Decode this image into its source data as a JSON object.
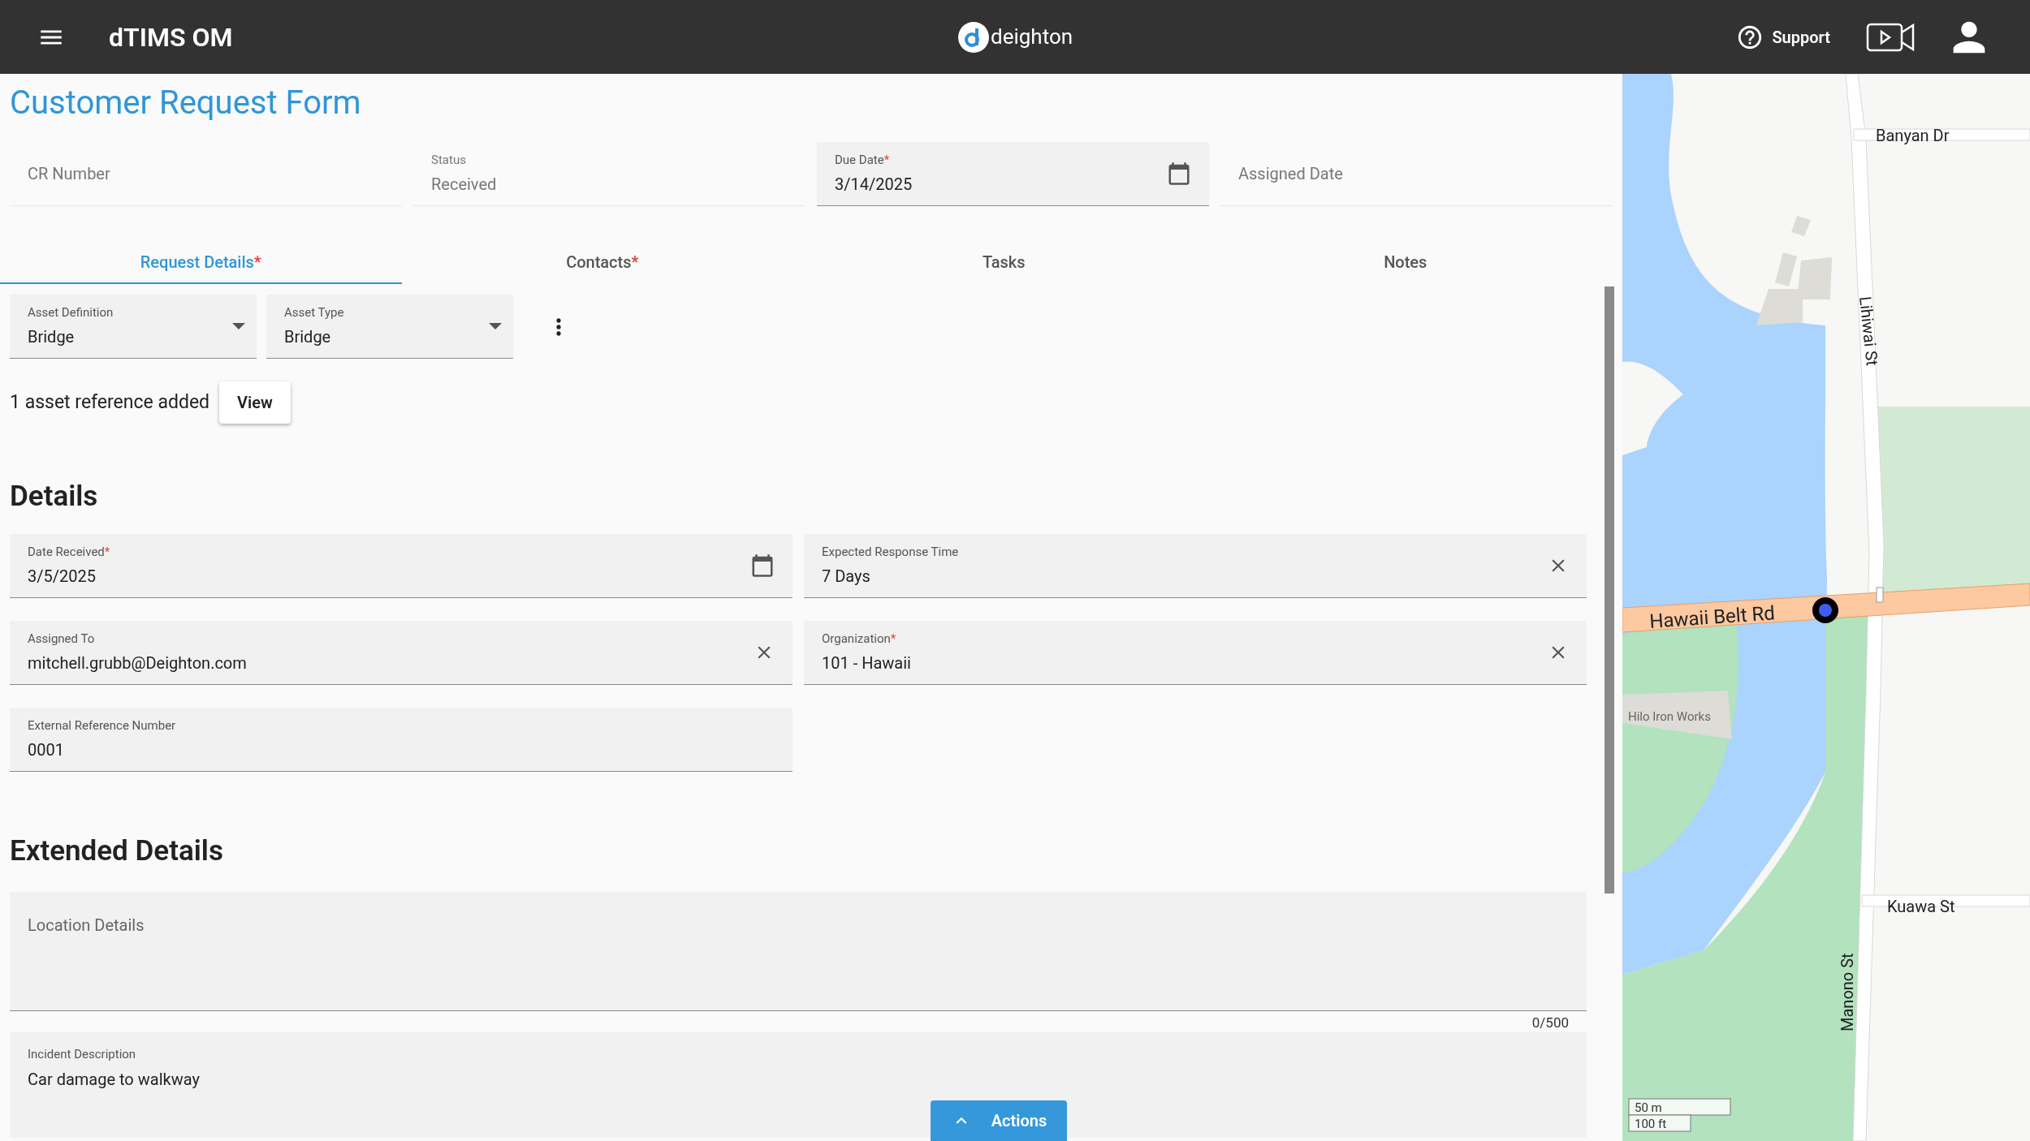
{
  "header": {
    "title": "dTIMS OM",
    "logo_text": "deighton",
    "support": "Support"
  },
  "form": {
    "title": "Customer Request Form",
    "top_fields": [
      {
        "label": "CR Number",
        "disabled": true,
        "kind": "plain"
      },
      {
        "label": "Status",
        "value": "Received",
        "disabled": true,
        "kind": "plain"
      },
      {
        "label": "Due Date",
        "required_mark": "*",
        "value": "3/14/2025",
        "disabled": false,
        "kind": "date"
      },
      {
        "label": "Assigned Date",
        "disabled": true,
        "kind": "plain"
      }
    ],
    "tabs": [
      {
        "label": "Request Details",
        "required_mark": "*",
        "selected": true
      },
      {
        "label": "Contacts",
        "required_mark": "*",
        "selected": false
      },
      {
        "label": "Tasks",
        "selected": false
      },
      {
        "label": "Notes",
        "selected": false
      }
    ],
    "asset_fields": [
      {
        "label": "Asset Definition",
        "value": "Bridge"
      },
      {
        "label": "Asset Type",
        "value": "Bridge"
      }
    ],
    "asset_reference": {
      "text": "1 asset reference added",
      "button": "View"
    },
    "details_heading": "Details",
    "detail_fields": [
      {
        "label": "Date Received",
        "required_mark": "*",
        "value": "3/5/2025",
        "kind": "date"
      },
      {
        "label": "Expected Response Time",
        "value": "7 Days",
        "kind": "clearable"
      },
      {
        "label": "Assigned To",
        "value": "mitchell.grubb@Deighton.com",
        "kind": "clearable"
      },
      {
        "label": "Organization",
        "required_mark": "*",
        "value": "101 - Hawaii",
        "kind": "clearable"
      },
      {
        "label": "External Reference Number",
        "value": "0001",
        "kind": "plain"
      }
    ],
    "extended_heading": "Extended Details",
    "location": {
      "placeholder": "Location Details",
      "counter": "0/500"
    },
    "incident": {
      "label": "Incident Description",
      "value": "Car damage to walkway"
    },
    "actions_button": "Actions"
  },
  "map": {
    "streets": [
      "Banyan Dr",
      "Lihiwai St",
      "Hawaii Belt Rd",
      "Kuawa St",
      "Manono St"
    ],
    "place": "Hilo Iron Works",
    "scale": [
      "50 m",
      "100 ft"
    ]
  }
}
